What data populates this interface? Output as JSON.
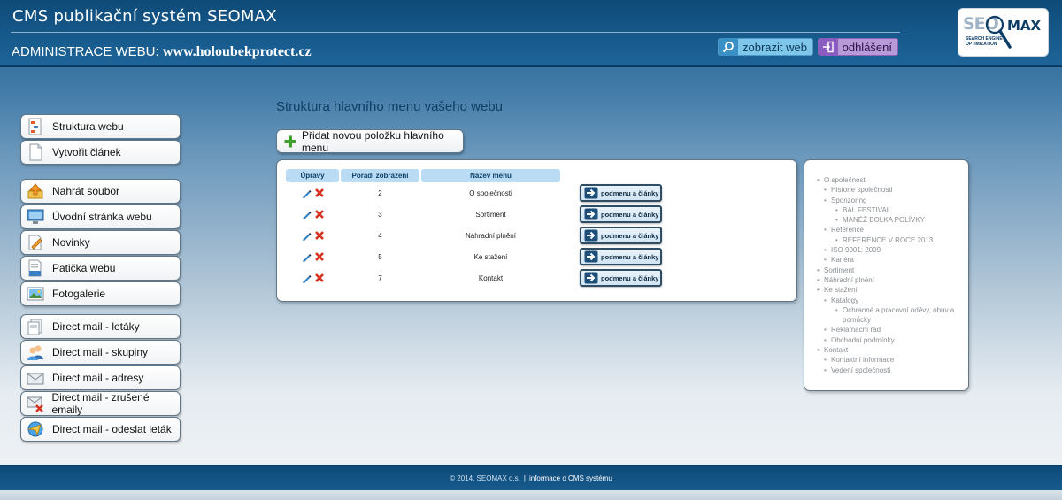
{
  "header": {
    "title": "CMS publikační systém SEOMAX",
    "admin_label": "ADMINISTRACE WEBU:",
    "domain": "www.holoubekprotect.cz",
    "view_web": "zobrazit web",
    "logout": "odhlášení",
    "logo": {
      "seo": "SEO",
      "max": "MAX",
      "tagline": "SEARCH ENGINE OPTIMIZATION"
    }
  },
  "sidebar": {
    "groups": [
      {
        "items": [
          {
            "label": "Struktura webu",
            "icon": "sitemap-icon"
          },
          {
            "label": "Vytvořit článek",
            "icon": "document-icon"
          }
        ]
      },
      {
        "items": [
          {
            "label": "Nahrát soubor",
            "icon": "upload-icon"
          },
          {
            "label": "Úvodní stránka webu",
            "icon": "monitor-icon"
          },
          {
            "label": "Novinky",
            "icon": "news-edit-icon"
          },
          {
            "label": "Patička webu",
            "icon": "footer-page-icon"
          },
          {
            "label": "Fotogalerie",
            "icon": "photo-gallery-icon"
          }
        ]
      },
      {
        "items": [
          {
            "label": "Direct mail - letáky",
            "icon": "flyer-icon"
          },
          {
            "label": "Direct mail - skupiny",
            "icon": "group-users-icon"
          },
          {
            "label": "Direct mail - adresy",
            "icon": "envelope-icon"
          },
          {
            "label": "Direct mail - zrušené emaily",
            "icon": "envelope-cancel-icon"
          },
          {
            "label": "Direct mail - odeslat leták",
            "icon": "send-mail-icon"
          }
        ]
      }
    ]
  },
  "main": {
    "title": "Struktura hlavního menu vašeho webu",
    "add_button": "Přidat novou položku hlavního menu",
    "table": {
      "headers": [
        "Úpravy",
        "Pořadí zobrazení",
        "Název menu"
      ],
      "rows": [
        {
          "order": "2",
          "name": "O společnosti",
          "action": "podmenu a články"
        },
        {
          "order": "3",
          "name": "Sortiment",
          "action": "podmenu a články"
        },
        {
          "order": "4",
          "name": "Náhradní plnění",
          "action": "podmenu a články"
        },
        {
          "order": "5",
          "name": "Ke stažení",
          "action": "podmenu a články"
        },
        {
          "order": "7",
          "name": "Kontakt",
          "action": "podmenu a články"
        }
      ]
    }
  },
  "tree": [
    {
      "label": "O společnosti",
      "children": [
        {
          "label": "Historie společnosti"
        },
        {
          "label": "Sponzoring",
          "children": [
            {
              "label": "BÁL FESTIVAL"
            },
            {
              "label": "MANÉŽ BOLKA POLÍVKY"
            }
          ]
        },
        {
          "label": "Reference",
          "children": [
            {
              "label": "REFERENCE V ROCE 2013"
            }
          ]
        },
        {
          "label": "ISO 9001: 2009"
        },
        {
          "label": "Kariéra"
        }
      ]
    },
    {
      "label": "Sortiment"
    },
    {
      "label": "Náhradní plnění"
    },
    {
      "label": "Ke stažení",
      "children": [
        {
          "label": "Katalogy",
          "children": [
            {
              "label": "Ochranné a pracovní oděvy, obuv a pomůcky"
            }
          ]
        },
        {
          "label": "Reklamační řád"
        },
        {
          "label": "Obchodní podmínky"
        }
      ]
    },
    {
      "label": "Kontakt",
      "children": [
        {
          "label": "Kontaktní informace"
        },
        {
          "label": "Vedení společnosti"
        }
      ]
    }
  ],
  "footer": {
    "copyright": "© 2014. SEOMAX o.s.",
    "separator": "|",
    "info_link": "informace o CMS systému"
  }
}
